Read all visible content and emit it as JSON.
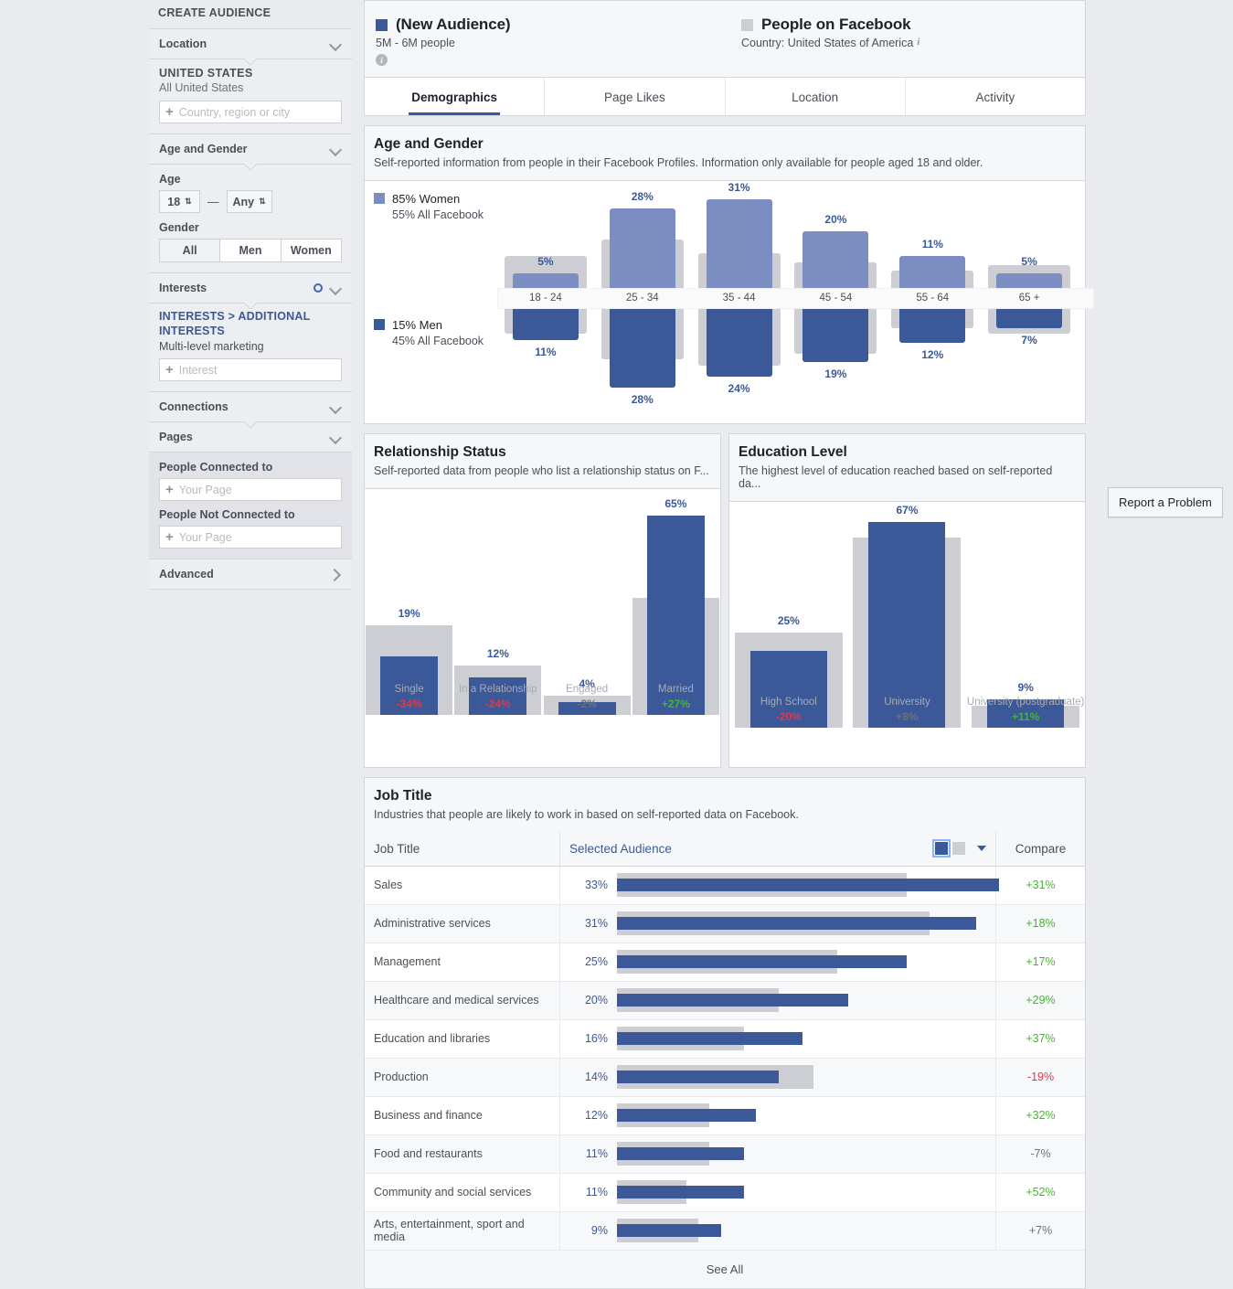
{
  "sidebar": {
    "title": "CREATE AUDIENCE",
    "location": {
      "header": "Location",
      "country_heading": "UNITED STATES",
      "country_sub": "All United States",
      "input_placeholder": "Country, region or city"
    },
    "age_gender": {
      "header": "Age and Gender",
      "age_label": "Age",
      "age_min": "18",
      "age_max": "Any",
      "dash": "—",
      "gender_label": "Gender",
      "gender_options": [
        "All",
        "Men",
        "Women"
      ],
      "gender_selected": "All"
    },
    "interests": {
      "header": "Interests",
      "breadcrumb_root": "INTERESTS",
      "breadcrumb_sep": ">",
      "breadcrumb_leaf": "ADDITIONAL INTERESTS",
      "selected": "Multi-level marketing",
      "input_placeholder": "Interest"
    },
    "connections": {
      "header": "Connections"
    },
    "pages": {
      "header": "Pages",
      "connected_label": "People Connected to",
      "connected_placeholder": "Your Page",
      "not_connected_label": "People Not Connected to",
      "not_connected_placeholder": "Your Page"
    },
    "advanced": {
      "header": "Advanced"
    }
  },
  "header": {
    "audience_name": "(New Audience)",
    "audience_size": "5M - 6M people",
    "compare_name": "People on Facebook",
    "compare_sub": "Country: United States of America",
    "info_glyph": "i"
  },
  "tabs": [
    {
      "label": "Demographics",
      "active": true
    },
    {
      "label": "Page Likes",
      "active": false
    },
    {
      "label": "Location",
      "active": false
    },
    {
      "label": "Activity",
      "active": false
    }
  ],
  "report_button": "Report a Problem",
  "age_gender_panel": {
    "title": "Age and Gender",
    "description": "Self-reported information from people in their Facebook Profiles. Information only available for people aged 18 and older.",
    "women_legend": "85% Women",
    "women_legend_sub": "55% All Facebook",
    "men_legend": "15% Men",
    "men_legend_sub": "45% All Facebook"
  },
  "relationship_panel": {
    "title": "Relationship Status",
    "description": "Self-reported data from people who list a relationship status on F..."
  },
  "education_panel": {
    "title": "Education Level",
    "description": "The highest level of education reached based on self-reported da..."
  },
  "job_panel": {
    "title": "Job Title",
    "description": "Industries that people are likely to work in based on self-reported data on Facebook.",
    "col_job": "Job Title",
    "col_audience": "Selected Audience",
    "col_compare": "Compare",
    "see_all": "See All"
  },
  "colors": {
    "audience_blue": "#3b5998",
    "women_blue": "#7b8dc1",
    "compare_gray": "#ccced3",
    "positive_green": "#42b72a",
    "negative_red": "#e0384a",
    "page_bg": "#e9ebee"
  },
  "chart_data": [
    {
      "type": "bar",
      "title": "Age and Gender",
      "orientation": "diverging-vertical",
      "categories": [
        "18 - 24",
        "25 - 34",
        "35 - 44",
        "45 - 54",
        "55 - 64",
        "65 +"
      ],
      "series": [
        {
          "name": "Women (Selected Audience)",
          "values": [
            5,
            28,
            31,
            20,
            11,
            5
          ],
          "labels": [
            "5%",
            "28%",
            "31%",
            "20%",
            "11%",
            "5%"
          ],
          "direction": "up",
          "color": "#7b8dc1"
        },
        {
          "name": "Men (Selected Audience)",
          "values": [
            11,
            28,
            24,
            19,
            12,
            7
          ],
          "labels": [
            "11%",
            "28%",
            "24%",
            "19%",
            "12%",
            "7%"
          ],
          "direction": "down",
          "color": "#3b5998"
        },
        {
          "name": "Women (All Facebook)",
          "values": [
            11,
            17,
            12,
            9,
            6,
            8
          ],
          "direction": "up",
          "color": "#ccced3"
        },
        {
          "name": "Men (All Facebook)",
          "values": [
            9,
            18,
            20,
            16,
            7,
            9
          ],
          "direction": "down",
          "color": "#ccced3"
        }
      ],
      "totals": {
        "women_audience": "85% Women",
        "women_all": "55% All Facebook",
        "men_audience": "15% Men",
        "men_all": "45% All Facebook"
      },
      "ylabel": "",
      "xlabel": "",
      "grid": false
    },
    {
      "type": "bar",
      "title": "Relationship Status",
      "categories": [
        "Single",
        "In a Relationship",
        "Engaged",
        "Married"
      ],
      "values": [
        19,
        12,
        4,
        65
      ],
      "labels": [
        "19%",
        "12%",
        "4%",
        "65%"
      ],
      "comparison_values": [
        29,
        16,
        6,
        38
      ],
      "compare_labels": [
        "-34%",
        "-24%",
        "-2%",
        "+27%"
      ],
      "compare_signs": [
        "neg",
        "neg",
        "neu",
        "pos"
      ],
      "ylim": [
        0,
        70
      ],
      "grid": false
    },
    {
      "type": "bar",
      "title": "Education Level",
      "categories": [
        "High School",
        "University",
        "University (postgraduate)"
      ],
      "values": [
        25,
        67,
        9
      ],
      "labels": [
        "25%",
        "67%",
        "9%"
      ],
      "comparison_values": [
        31,
        62,
        7
      ],
      "compare_labels": [
        "-20%",
        "+8%",
        "+11%"
      ],
      "compare_signs": [
        "neg",
        "neu",
        "pos"
      ],
      "ylim": [
        0,
        70
      ],
      "grid": false
    },
    {
      "type": "bar",
      "title": "Job Title",
      "orientation": "horizontal",
      "categories": [
        "Sales",
        "Administrative services",
        "Management",
        "Healthcare and medical services",
        "Education and libraries",
        "Production",
        "Business and finance",
        "Food and restaurants",
        "Community and social services",
        "Arts, entertainment, sport and media"
      ],
      "values": [
        33,
        31,
        25,
        20,
        16,
        14,
        12,
        11,
        11,
        9
      ],
      "labels": [
        "33%",
        "31%",
        "25%",
        "20%",
        "16%",
        "14%",
        "12%",
        "11%",
        "11%",
        "9%"
      ],
      "comparison_values": [
        25,
        27,
        19,
        14,
        11,
        17,
        8,
        8,
        6,
        7
      ],
      "compare_labels": [
        "+31%",
        "+18%",
        "+17%",
        "+29%",
        "+37%",
        "-19%",
        "+32%",
        "-7%",
        "+52%",
        "+7%"
      ],
      "compare_signs": [
        "pos",
        "pos",
        "pos",
        "pos",
        "pos",
        "neg",
        "pos",
        "neu",
        "pos",
        "neu"
      ]
    }
  ]
}
